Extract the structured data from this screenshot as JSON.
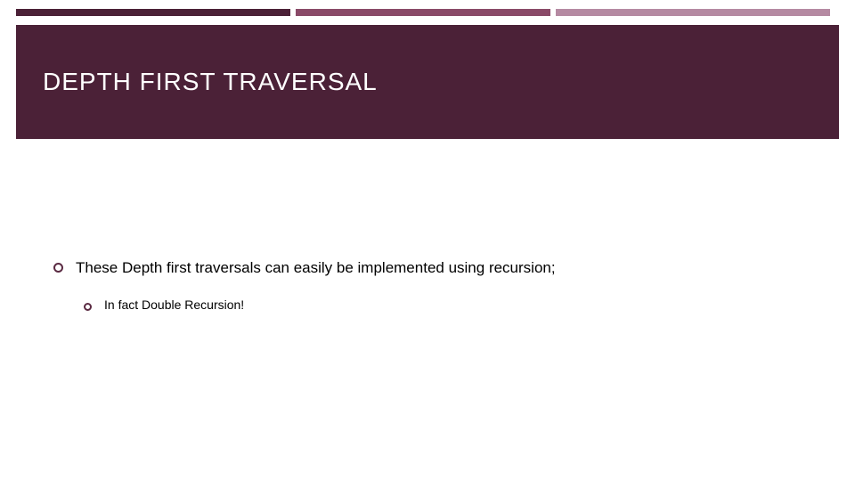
{
  "colors": {
    "brand_dark": "#4b2137",
    "accent_mid": "#8a4a68",
    "accent_light": "#b58aa2",
    "bullet_color": "#5a2a42"
  },
  "title": "DEPTH FIRST TRAVERSAL",
  "bullets": [
    {
      "text": "These Depth first traversals can easily be implemented using recursion;",
      "children": [
        {
          "text": "In fact Double Recursion!"
        }
      ]
    }
  ]
}
